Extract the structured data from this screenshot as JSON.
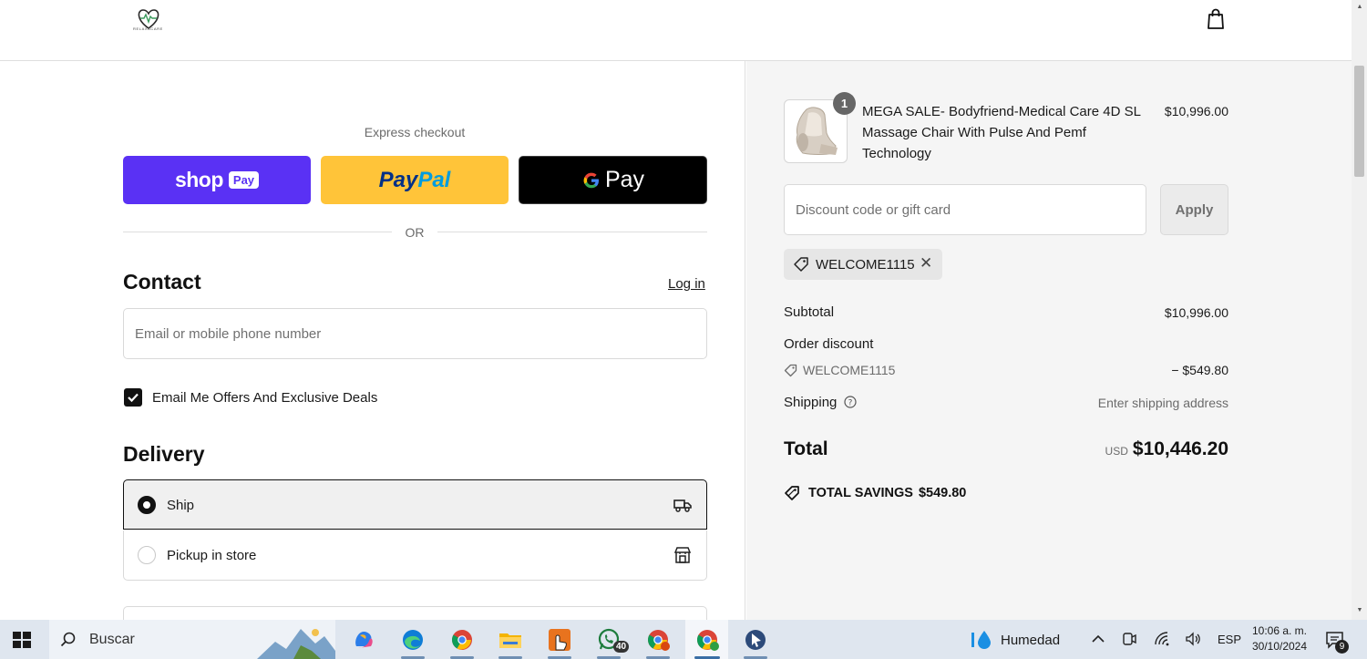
{
  "store": {
    "logo_text": "RELAXACARE"
  },
  "express": {
    "title": "Express checkout",
    "shop_pay_word": "shop",
    "shop_pay_pill": "Pay",
    "paypal_1": "Pay",
    "paypal_2": "Pal",
    "gpay_word": "Pay",
    "or": "OR"
  },
  "contact": {
    "heading": "Contact",
    "login": "Log in",
    "email_placeholder": "Email or mobile phone number",
    "offers_label": "Email Me Offers And Exclusive Deals",
    "offers_checked": true
  },
  "delivery": {
    "heading": "Delivery",
    "options": [
      {
        "label": "Ship",
        "selected": true,
        "icon": "truck-icon"
      },
      {
        "label": "Pickup in store",
        "selected": false,
        "icon": "store-icon"
      }
    ]
  },
  "cart": {
    "item": {
      "quantity": "1",
      "name": "MEGA SALE- Bodyfriend-Medical Care 4D SL Massage Chair With Pulse And Pemf Technology",
      "price": "$10,996.00"
    },
    "discount_placeholder": "Discount code or gift card",
    "apply_label": "Apply",
    "applied_code": "WELCOME1115",
    "subtotal_label": "Subtotal",
    "subtotal_value": "$10,996.00",
    "order_discount_label": "Order discount",
    "discount_code": "WELCOME1115",
    "discount_value": "− $549.80",
    "shipping_label": "Shipping",
    "shipping_value": "Enter shipping address",
    "total_label": "Total",
    "total_currency": "USD",
    "total_value": "$10,446.20",
    "savings_label": "TOTAL SAVINGS",
    "savings_value": "$549.80"
  },
  "taskbar": {
    "search_text": "Buscar",
    "whatsapp_count": "40",
    "weather": "Humedad",
    "language": "ESP",
    "time": "10:06 a. m.",
    "date": "30/10/2024",
    "notifications": "9"
  },
  "colors": {
    "shop_pay": "#5a31f4",
    "paypal": "#ffc439",
    "gpay": "#000000",
    "sidebar_bg": "#f5f5f5"
  }
}
